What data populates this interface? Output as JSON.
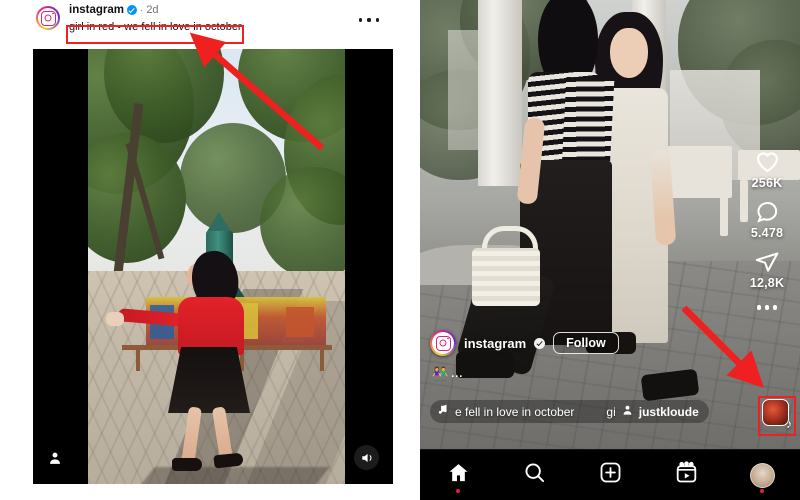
{
  "app": {
    "name": "Instagram",
    "accent_red": "#ef2020",
    "verified_blue": "#0095f6",
    "nav_dot_red": "#e11d48"
  },
  "left_panel": {
    "name": "feed-post",
    "header": {
      "avatar_icon": "instagram-logo-icon",
      "username": "instagram",
      "verified_icon": "verified-badge-icon",
      "separator": "·",
      "time_ago": "2d",
      "more_icon": "more-options-icon"
    },
    "caption": "girl in red • we fell in love in october",
    "caption_highlighted": true,
    "media": {
      "type": "video",
      "description": "girl in red top and black skirt walking in a park plaza with a rocket playground ride",
      "person_tag_icon": "person-tag-icon",
      "mute_icon": "volume-on-icon"
    },
    "annotation": {
      "type": "arrow",
      "color": "#ef2020",
      "points_to": "caption",
      "direction": "up-left"
    }
  },
  "right_panel": {
    "name": "reels-player",
    "media": {
      "type": "reel-video",
      "description": "two girls walking in a courtyard with white columns and benches"
    },
    "rail": [
      {
        "icon": "heart-icon",
        "label": "256K",
        "name": "like-button"
      },
      {
        "icon": "comment-icon",
        "label": "5.478",
        "name": "comment-button"
      },
      {
        "icon": "share-icon",
        "label": "12,8K",
        "name": "share-button"
      },
      {
        "icon": "more-options-icon",
        "label": "",
        "name": "reel-more-button"
      }
    ],
    "account": {
      "avatar_icon": "instagram-logo-icon",
      "username": "instagram",
      "verified_icon": "verified-badge-icon",
      "follow_label": "Follow"
    },
    "reel_caption": {
      "emoji": "👫",
      "more_label": "..."
    },
    "music": {
      "note_icon": "music-note-icon",
      "title": "e fell in love in october",
      "title_tail": "gi",
      "author_icon": "person-icon",
      "author": "justkloude",
      "album_icon": "album-art-icon",
      "album_badge_icon": "music-note-icon",
      "album_highlighted": true
    },
    "annotation": {
      "type": "arrow",
      "color": "#ef2020",
      "points_to": "music-album-thumbnail",
      "direction": "down-right"
    },
    "bottom_nav": [
      {
        "icon": "home-icon",
        "name": "nav-home",
        "active": true,
        "dot": true
      },
      {
        "icon": "search-icon",
        "name": "nav-search",
        "active": false,
        "dot": false
      },
      {
        "icon": "create-icon",
        "name": "nav-create",
        "active": false,
        "dot": false
      },
      {
        "icon": "reels-icon",
        "name": "nav-reels",
        "active": false,
        "dot": false
      },
      {
        "icon": "profile-avatar-icon",
        "name": "nav-profile",
        "active": false,
        "dot": true
      }
    ]
  }
}
